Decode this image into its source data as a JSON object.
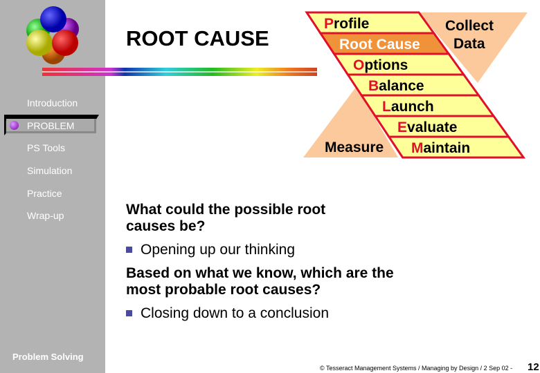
{
  "slide": {
    "title": "ROOT CAUSE"
  },
  "sidebar": {
    "items": [
      {
        "label": "Introduction"
      },
      {
        "label": "PROBLEM",
        "active": true
      },
      {
        "label": "PS Tools"
      },
      {
        "label": "Simulation"
      },
      {
        "label": "Practice"
      },
      {
        "label": "Wrap-up"
      }
    ],
    "footer": "Problem Solving"
  },
  "diagram": {
    "steps": [
      {
        "initial": "P",
        "rest": "rofile"
      },
      {
        "initial": "",
        "rest": "Root Cause",
        "highlighted": true
      },
      {
        "initial": "O",
        "rest": "ptions"
      },
      {
        "initial": "B",
        "rest": "alance"
      },
      {
        "initial": "L",
        "rest": "aunch"
      },
      {
        "initial": "E",
        "rest": "valuate"
      },
      {
        "initial": "M",
        "rest": "aintain"
      }
    ],
    "collect": "Collect",
    "data": "Data",
    "measure": "Measure"
  },
  "content": {
    "q1": "What could the possible root causes be?",
    "b1": "Opening up our thinking",
    "q2": "Based on what we know, which are the most probable root causes?",
    "b2": "Closing down to a conclusion"
  },
  "footer": {
    "copyright": "© Tesseract Management Systems / Managing by Design / 2 Sep 02  -",
    "page": "12"
  },
  "colors": {
    "sidebar": "#b3b3b3",
    "band": "#ffff99",
    "highlight": "#f0923a",
    "outline": "#e0102a",
    "peach": "#fcc99c"
  }
}
